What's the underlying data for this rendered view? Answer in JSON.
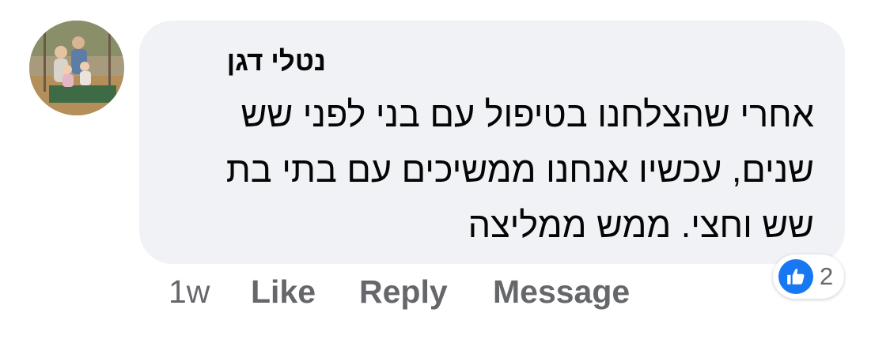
{
  "comment": {
    "author": "נטלי דגן",
    "text_lines": [
      "אחרי שהצלחנו בטיפול עם בני לפני שש",
      "שנים, עכשיו אנחנו ממשיכים עם בתי בת",
      "שש וחצי. ממש ממליצה"
    ]
  },
  "actions": {
    "time": "1w",
    "like": "Like",
    "reply": "Reply",
    "message": "Message"
  },
  "reactions": {
    "icon": "thumbs-up-icon",
    "count": "2",
    "color": "#1877f2"
  },
  "colors": {
    "bubble": "#f0f2f5",
    "text": "#050505",
    "secondary": "#65676b"
  }
}
